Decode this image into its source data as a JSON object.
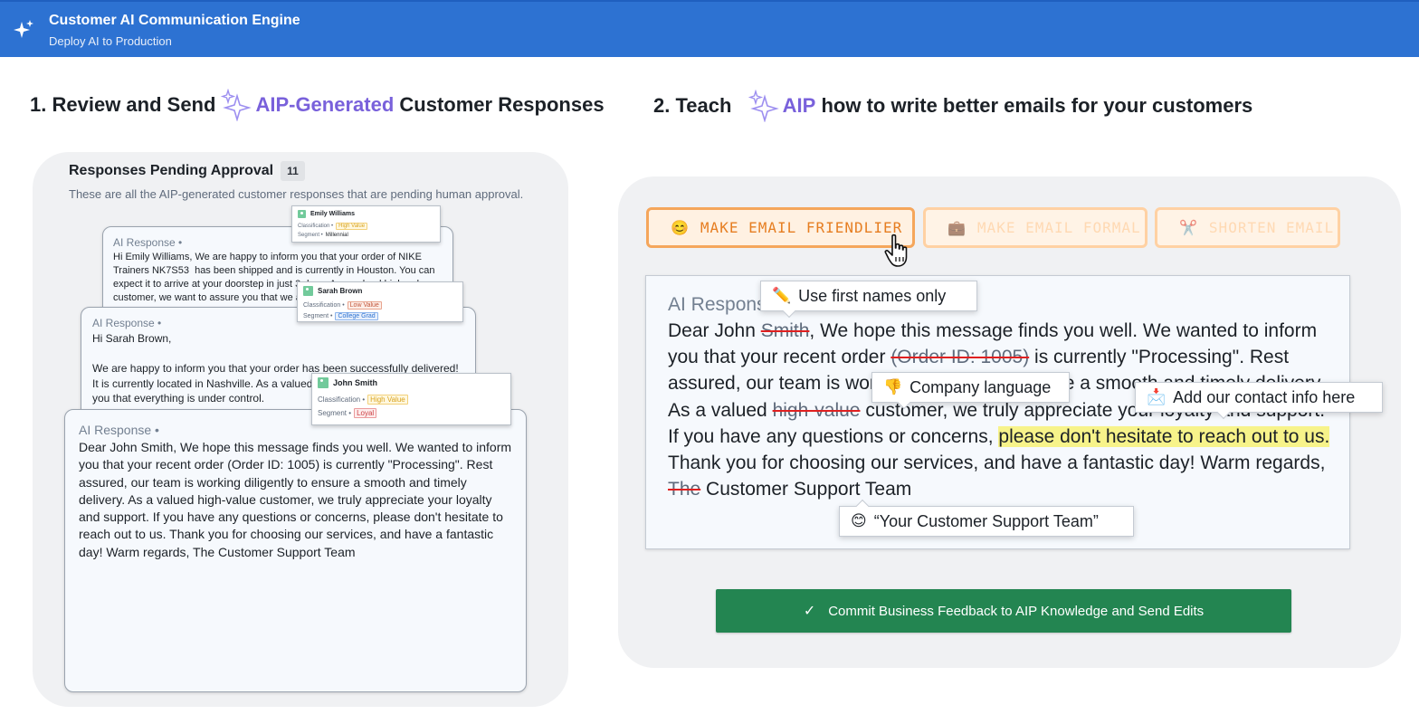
{
  "header": {
    "title": "Customer AI Communication Engine",
    "subtitle": "Deploy AI to Production",
    "icon": "sparkle-icon"
  },
  "section1": {
    "number": "1.",
    "pre": "Review and Send",
    "aip": "AIP-Generated",
    "post": "Customer Responses"
  },
  "section2": {
    "number": "2.",
    "pre": "Teach",
    "aip": "AIP",
    "post": "how to write better emails for your customers"
  },
  "pending": {
    "title": "Responses Pending Approval",
    "count": "11",
    "description": "These are all the AIP-generated customer responses that are pending human approval."
  },
  "cards": [
    {
      "label": "AI Response",
      "body": "Hi Emily Williams, We are happy to inform you that your order of NIKE Trainers NK7S53  has been shipped and is currently in Houston. You can expect it to arrive at your doorstep in just 3 days. As a valued high-value customer, we want to assure you that we are committed to providing you with a smooth and timely delivery experience."
    },
    {
      "label": "AI Response",
      "body": "Hi Sarah Brown,\n\nWe are happy to inform you that your order has been successfully delivered! It is currently located in Nashville. As a valued customer, we want to assure you that everything is under control."
    },
    {
      "label": "AI Response",
      "body": "Dear John Smith, We hope this message finds you well. We wanted to inform you that your recent order (Order ID: 1005) is currently \"Processing\". Rest assured, our team is working diligently to ensure a smooth and timely delivery. As a valued high-value customer, we truly appreciate your loyalty and support. If you have any questions or concerns, please don't hesitate to reach out to us. Thank you for choosing our services, and have a fantastic day! Warm regards, The Customer Support Team"
    }
  ],
  "customers": [
    {
      "name": "Emily Williams",
      "classification_label": "Classification",
      "classification": "High Value",
      "segment_label": "Segment",
      "segment": "Millennial",
      "class_color": "#d9a31f",
      "seg_color": "#1c2127"
    },
    {
      "name": "Sarah Brown",
      "classification_label": "Classification",
      "classification": "Low Value",
      "segment_label": "Segment",
      "segment": "College Grad",
      "class_color": "#c2553a",
      "seg_color": "#2d72d2"
    },
    {
      "name": "John Smith",
      "classification_label": "Classification",
      "classification": "High Value",
      "segment_label": "Segment",
      "segment": "Loyal",
      "class_color": "#d9a31f",
      "seg_color": "#cd4246"
    }
  ],
  "actions": [
    {
      "label": "MAKE EMAIL FRIENDLIER",
      "icon": "😊",
      "icon_name": "smile-icon"
    },
    {
      "label": "MAKE EMAIL FORMAL",
      "icon": "💼",
      "icon_name": "briefcase-icon"
    },
    {
      "label": "SHORTEN EMAIL",
      "icon": "✂️",
      "icon_name": "scissors-icon"
    }
  ],
  "editor": {
    "label": "AI Response",
    "segments": [
      {
        "t": "Dear John "
      },
      {
        "t": "Smith",
        "s": "strike"
      },
      {
        "t": ", We hope this message finds you well. We wanted to inform you that your recent order "
      },
      {
        "t": "(Order ID: 1005)",
        "s": "strike"
      },
      {
        "t": " is currently \"Processing\". Rest assured, our team is working diligently to ensure a smooth and timely delivery. As a valued "
      },
      {
        "t": "high-value",
        "s": "strike"
      },
      {
        "t": " customer, we truly appreciate your loyalty and support. If you have any questions or concerns, "
      },
      {
        "t": "please don't hesitate to reach out to us.",
        "s": "hl"
      },
      {
        "t": " Thank you for choosing our services, and have a fantastic day! Warm regards, "
      },
      {
        "t": "The",
        "s": "strike"
      },
      {
        "t": " Customer Support Team"
      }
    ]
  },
  "feedback": [
    {
      "icon": "✏️",
      "icon_name": "pencil-icon",
      "text": "Use first names only"
    },
    {
      "icon": "👎",
      "icon_name": "thumbs-down-icon",
      "text": "Company language"
    },
    {
      "icon": "📩",
      "icon_name": "envelope-icon",
      "text": "Add our contact info here"
    },
    {
      "icon": "😊",
      "icon_name": "smile-icon",
      "text": "“Your Customer Support Team”"
    }
  ],
  "commit": {
    "label": "Commit Business Feedback to AIP Knowledge and Send Edits",
    "icon": "✓"
  }
}
